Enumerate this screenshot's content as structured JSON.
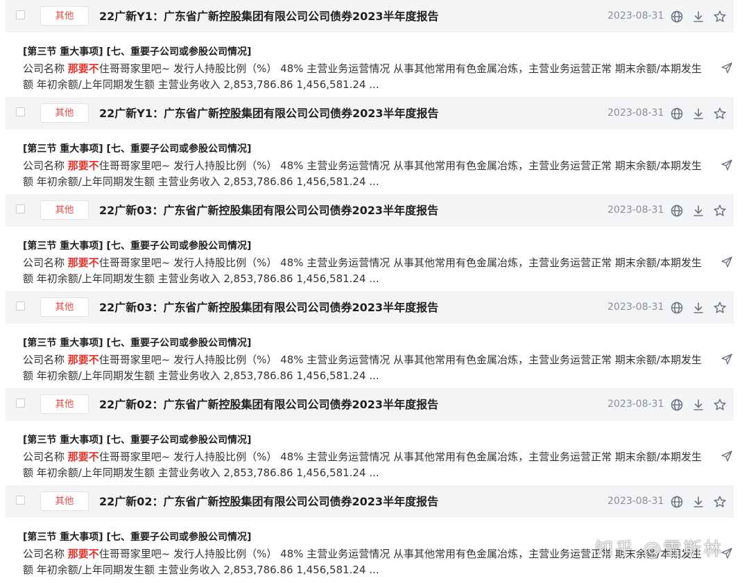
{
  "results": [
    {
      "tag": "其他",
      "title": "22广新Y1：广东省广新控股集团有限公司公司债券2023半年度报告",
      "date": "2023-08-31",
      "section": "[第三节 重大事项] [七、重要子公司或参股公司情况]",
      "text_before": "公司名称 ",
      "highlight": "那要不",
      "text_after": "住哥哥家里吧~ 发行人持股比例（%） 48% 主营业务运营情况 从事其他常用有色金属冶炼，主营业务运营正常 期末余额/本期发生额 年初余额/上年同期发生额 主营业务收入 2,853,786.86 1,456,581.24 ..."
    },
    {
      "tag": "其他",
      "title": "22广新Y1：广东省广新控股集团有限公司公司债券2023半年度报告",
      "date": "2023-08-31",
      "section": "[第三节 重大事项] [七、重要子公司或参股公司情况]",
      "text_before": "公司名称 ",
      "highlight": "那要不",
      "text_after": "住哥哥家里吧~ 发行人持股比例（%） 48% 主营业务运营情况 从事其他常用有色金属冶炼，主营业务运营正常 期末余额/本期发生额 年初余额/上年同期发生额 主营业务收入 2,853,786.86 1,456,581.24 ..."
    },
    {
      "tag": "其他",
      "title": "22广新03：广东省广新控股集团有限公司公司债券2023半年度报告",
      "date": "2023-08-31",
      "section": "[第三节 重大事项] [七、重要子公司或参股公司情况]",
      "text_before": "公司名称 ",
      "highlight": "那要不",
      "text_after": "住哥哥家里吧~ 发行人持股比例（%） 48% 主营业务运营情况 从事其他常用有色金属冶炼，主营业务运营正常 期末余额/本期发生额 年初余额/上年同期发生额 主营业务收入 2,853,786.86 1,456,581.24 ..."
    },
    {
      "tag": "其他",
      "title": "22广新03：广东省广新控股集团有限公司公司债券2023半年度报告",
      "date": "2023-08-31",
      "section": "[第三节 重大事项] [七、重要子公司或参股公司情况]",
      "text_before": "公司名称 ",
      "highlight": "那要不",
      "text_after": "住哥哥家里吧~ 发行人持股比例（%） 48% 主营业务运营情况 从事其他常用有色金属冶炼，主营业务运营正常 期末余额/本期发生额 年初余额/上年同期发生额 主营业务收入 2,853,786.86 1,456,581.24 ..."
    },
    {
      "tag": "其他",
      "title": "22广新02：广东省广新控股集团有限公司公司债券2023半年度报告",
      "date": "2023-08-31",
      "section": "[第三节 重大事项] [七、重要子公司或参股公司情况]",
      "text_before": "公司名称 ",
      "highlight": "那要不",
      "text_after": "住哥哥家里吧~ 发行人持股比例（%） 48% 主营业务运营情况 从事其他常用有色金属冶炼，主营业务运营正常 期末余额/本期发生额 年初余额/上年同期发生额 主营业务收入 2,853,786.86 1,456,581.24 ..."
    },
    {
      "tag": "其他",
      "title": "22广新02：广东省广新控股集团有限公司公司债券2023半年度报告",
      "date": "2023-08-31",
      "section": "[第三节 重大事项] [七、重要子公司或参股公司情况]",
      "text_before": "公司名称 ",
      "highlight": "那要不",
      "text_after": "住哥哥家里吧~ 发行人持股比例（%） 48% 主营业务运营情况 从事其他常用有色金属冶炼，主营业务运营正常 期末余额/本期发生额 年初余额/上年同期发生额 主营业务收入 2,853,786.86 1,456,581.24 ..."
    }
  ],
  "icons": {
    "open_web": "globe-icon",
    "download": "download-icon",
    "favorite": "star-icon",
    "share": "send-icon"
  },
  "colors": {
    "tag_text": "#e24b4b",
    "highlight": "#e5322d",
    "header_bg": "#f3f4f6",
    "date": "#8a8f99"
  },
  "watermark": "知乎 @雪斯林"
}
